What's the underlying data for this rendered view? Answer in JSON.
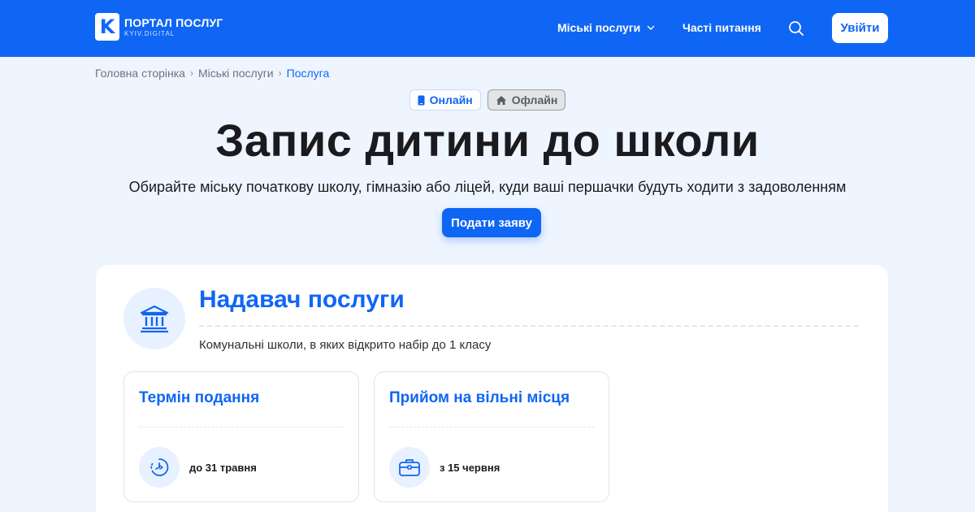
{
  "header": {
    "logo_letter": "K",
    "logo_title": "ПОРТАЛ ПОСЛУГ",
    "logo_subtitle": "KYIV.DIGITAL",
    "nav": [
      {
        "label": "Міські послуги"
      },
      {
        "label": "Часті питання"
      }
    ],
    "login_label": "Увійти"
  },
  "breadcrumb": [
    "Головна сторінка",
    "Міські послуги",
    "Послуга"
  ],
  "badges": {
    "online": "Онлайн",
    "offline": "Офлайн"
  },
  "hero": {
    "title": "Запис дитини до школи",
    "subtitle": "Обирайте міську початкову школу, гімназію або ліцей, куди ваші першачки будуть ходити з задоволенням",
    "apply_label": "Подати заяву"
  },
  "provider": {
    "title": "Надавач послуги",
    "description": "Комунальні школи, в яких відкрито набір до 1 класу"
  },
  "info_cards": [
    {
      "title": "Термін подання",
      "value": "до 31 травня",
      "icon": "deadline-icon"
    },
    {
      "title": "Прийом на вільні місця",
      "value": "з 15 червня",
      "icon": "briefcase-icon"
    }
  ],
  "colors": {
    "brand": "#1066f4",
    "page_bg": "#eef5ff",
    "icon_bg": "#e8f1ff"
  }
}
